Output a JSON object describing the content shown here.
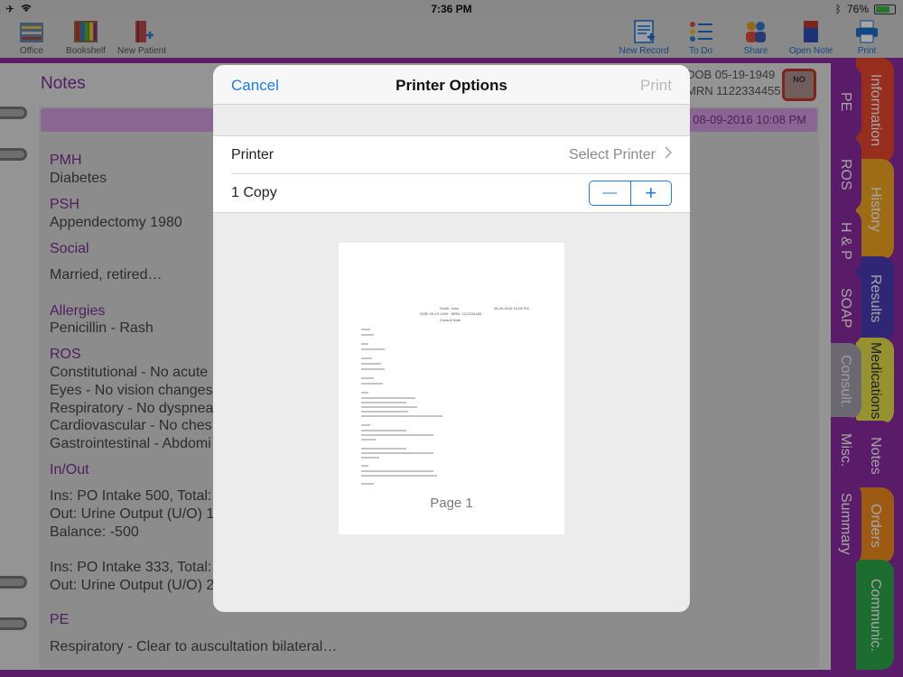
{
  "status": {
    "time": "7:36 PM",
    "battery": "76%",
    "battery_level": 0.76
  },
  "toolbar": {
    "left": [
      {
        "label": "Office",
        "icon": "office-icon"
      },
      {
        "label": "Bookshelf",
        "icon": "bookshelf-icon"
      },
      {
        "label": "New Patient",
        "icon": "new-patient-icon"
      }
    ],
    "right": [
      {
        "label": "New Record",
        "icon": "new-record-icon"
      },
      {
        "label": "To Do",
        "icon": "todo-icon"
      },
      {
        "label": "Share",
        "icon": "share-icon"
      },
      {
        "label": "Open Note",
        "icon": "open-note-icon"
      },
      {
        "label": "Print",
        "icon": "printer-icon"
      }
    ]
  },
  "notes": {
    "title": "Notes",
    "dob": "DOB 05-19-1949",
    "mrn": "MRN 1122334455",
    "timestamp": "08-09-2016 10:08 PM",
    "no_icon_text": "NO",
    "sections": [
      {
        "head": "PMH",
        "lines": [
          "Diabetes"
        ]
      },
      {
        "head": "PSH",
        "lines": [
          "Appendectomy 1980"
        ]
      },
      {
        "head": "Social",
        "lines": [
          "Married, retired…"
        ]
      },
      {
        "head": "Allergies",
        "lines": [
          "Penicillin  - Rash"
        ]
      },
      {
        "head": "ROS",
        "lines": [
          "Constitutional - No acute",
          "Eyes - No vision changes",
          "Respiratory - No dyspnea",
          "Cardiovascular - No ches",
          "Gastrointestinal - Abdomi"
        ]
      },
      {
        "head": "In/Out",
        "lines": [
          "Ins: PO Intake 500, Total:",
          "Out: Urine Output (U/O) 1",
          "Balance: -500",
          "Ins: PO Intake 333, Total:",
          "Out: Urine Output (U/O) 2"
        ]
      },
      {
        "head": "PE",
        "lines": [
          "Respiratory - Clear to auscultation bilateral…"
        ]
      }
    ]
  },
  "inner_tabs": [
    "PE",
    "ROS",
    "H & P",
    "SOAP",
    "Consult.",
    "Misc.",
    "Summary"
  ],
  "outer_tabs": [
    {
      "label": "Information",
      "color": "#e8452c"
    },
    {
      "label": "History",
      "color": "#f5a623"
    },
    {
      "label": "Results",
      "color": "#4a3bb5"
    },
    {
      "label": "Medications",
      "color": "#e8e04a"
    },
    {
      "label": "Notes",
      "color": "#8a2aa1"
    },
    {
      "label": "Orders",
      "color": "#f08a1c"
    },
    {
      "label": "Communic.",
      "color": "#2ea84a"
    }
  ],
  "modal": {
    "cancel": "Cancel",
    "title": "Printer Options",
    "print": "Print",
    "printer_label": "Printer",
    "printer_value": "Select Printer",
    "copies_label": "1 Copy",
    "minus": "—",
    "plus": "+",
    "page_label": "Page 1",
    "preview": {
      "name": "Smith, John",
      "date": "08-09-2016 10:08 PM",
      "meta": "DOB: 05-19-1949 · MRN: 1122334455",
      "doc_title": "Consult Note"
    }
  },
  "colors": {
    "accent": "#1b7cf0",
    "binder": "#8a2aa1",
    "heading": "#7a2e93"
  }
}
